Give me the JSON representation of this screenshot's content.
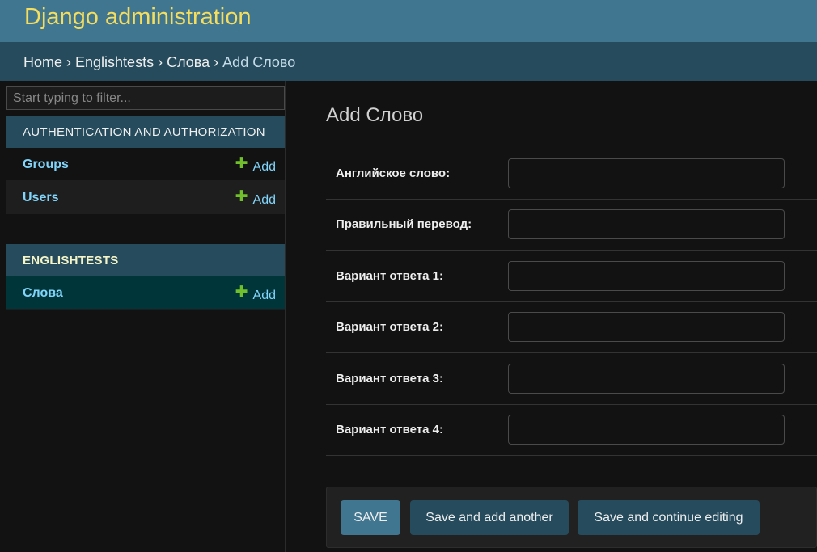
{
  "header": {
    "title": "Django administration"
  },
  "breadcrumbs": {
    "home": "Home",
    "app": "Englishtests",
    "model": "Слова",
    "current": "Add Слово",
    "separator": "›"
  },
  "sidebar": {
    "filter_placeholder": "Start typing to filter...",
    "modules": [
      {
        "name": "AUTHENTICATION AND AUTHORIZATION",
        "items": [
          {
            "label": "Groups",
            "add": "Add"
          },
          {
            "label": "Users",
            "add": "Add"
          }
        ]
      },
      {
        "name": "ENGLISHTESTS",
        "items": [
          {
            "label": "Слова",
            "add": "Add"
          }
        ]
      }
    ]
  },
  "main": {
    "title": "Add Слово",
    "fields": [
      {
        "label": "Английское слово:",
        "value": ""
      },
      {
        "label": "Правильный перевод:",
        "value": ""
      },
      {
        "label": "Вариант ответа 1:",
        "value": ""
      },
      {
        "label": "Вариант ответа 2:",
        "value": ""
      },
      {
        "label": "Вариант ответа 3:",
        "value": ""
      },
      {
        "label": "Вариант ответа 4:",
        "value": ""
      }
    ],
    "buttons": {
      "save": "SAVE",
      "save_add_another": "Save and add another",
      "save_continue": "Save and continue editing"
    }
  },
  "colors": {
    "header_bg": "#417690",
    "brand_text": "#f5dd5d",
    "breadcrumb_bg": "#264b5d",
    "link": "#81d4fa",
    "add_icon": "#70bf2b",
    "selected_row": "#00363a"
  },
  "icons": {
    "add": "plus-icon"
  }
}
